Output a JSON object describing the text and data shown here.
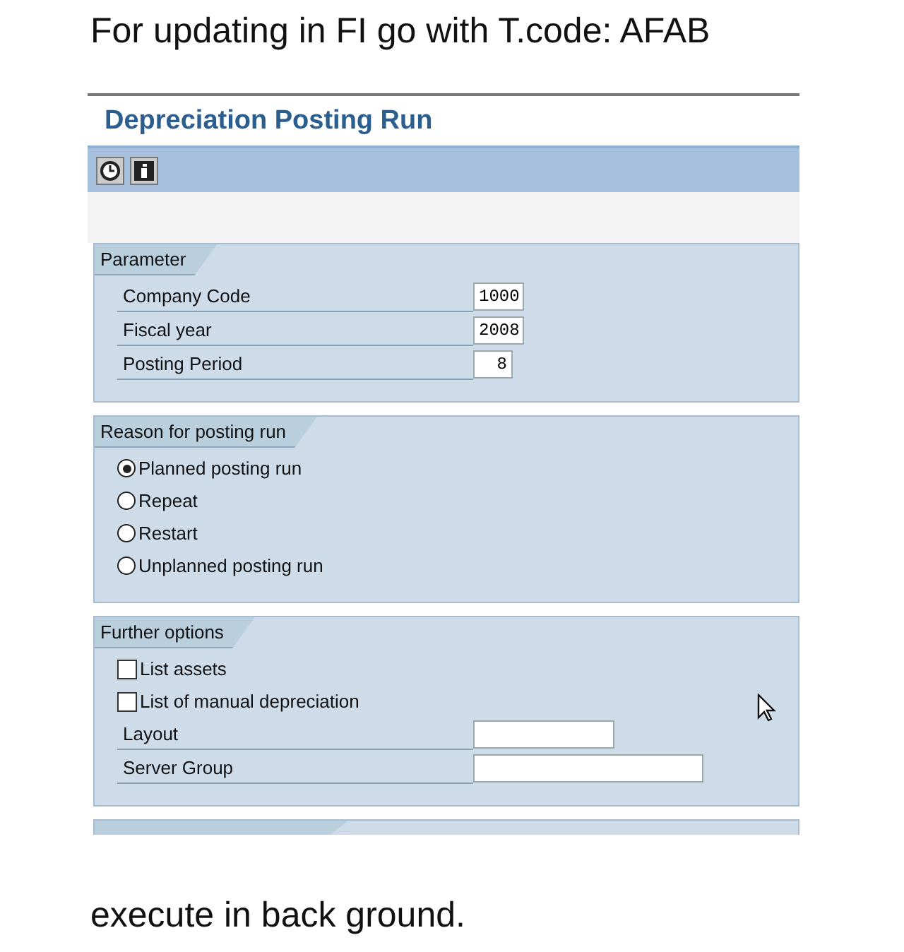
{
  "caption": "For updating in FI go with T.code: AFAB",
  "window": {
    "title": "Depreciation Posting Run"
  },
  "toolbar": [
    {
      "kind": "execute"
    },
    {
      "kind": "info"
    }
  ],
  "sections": [
    {
      "title": "Parameter",
      "rows": [
        {
          "kind": "field",
          "label": "Company Code",
          "value": "1000"
        },
        {
          "kind": "field",
          "label": "Fiscal year",
          "value": "2008"
        },
        {
          "kind": "field",
          "label": "Posting Period",
          "value": "8"
        }
      ]
    },
    {
      "title": "Reason for posting run",
      "rows": [
        {
          "kind": "radio",
          "label": "Planned posting run",
          "selected": true
        },
        {
          "kind": "radio",
          "label": "Repeat",
          "selected": false
        },
        {
          "kind": "radio",
          "label": "Restart",
          "selected": false
        },
        {
          "kind": "radio",
          "label": "Unplanned posting run",
          "selected": false
        }
      ]
    },
    {
      "title": "Further options",
      "rows": [
        {
          "kind": "checkbox",
          "label": "List assets",
          "checked": false
        },
        {
          "kind": "checkbox",
          "label": "List of manual depreciation",
          "checked": false
        },
        {
          "kind": "field",
          "label": "Layout",
          "value": ""
        },
        {
          "kind": "field",
          "label": "Server Group",
          "value": ""
        }
      ]
    }
  ],
  "footer": "execute in back ground."
}
